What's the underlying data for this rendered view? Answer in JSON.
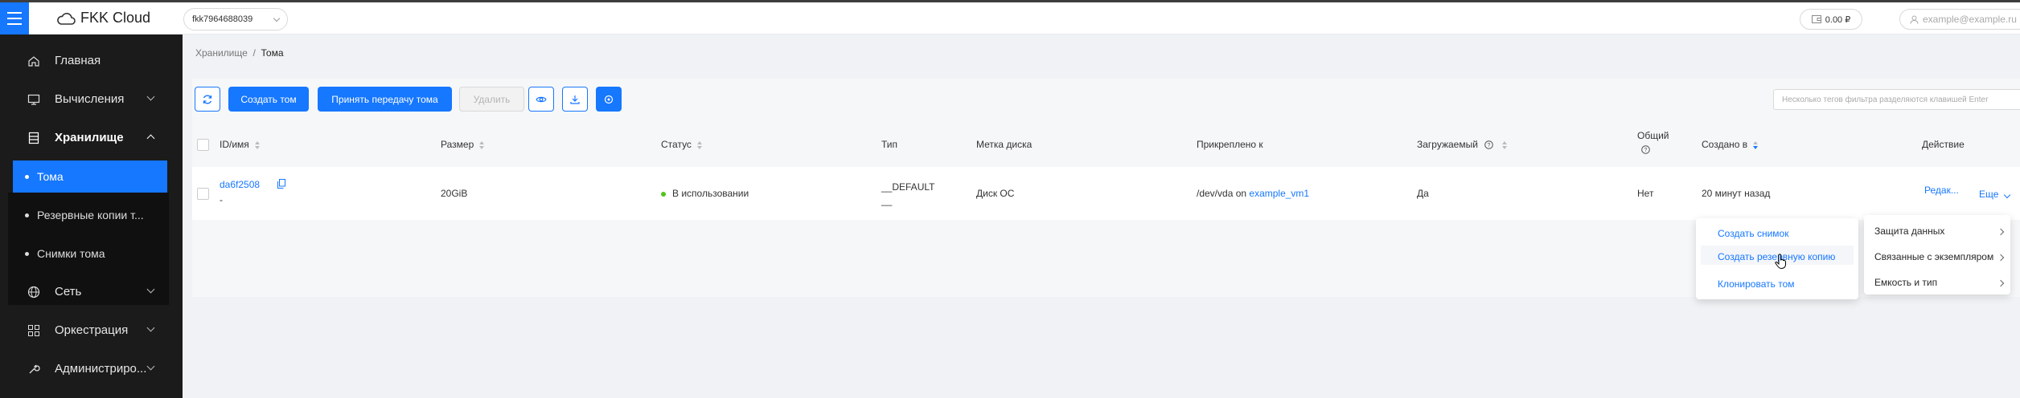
{
  "app": {
    "logo_text": "FKK Cloud",
    "project": "fkk7964688039",
    "balance": "0.00 ₽",
    "user": "example@example.ru"
  },
  "sidebar": {
    "items": [
      {
        "label": "Главная",
        "icon": "home-icon"
      },
      {
        "label": "Вычисления",
        "icon": "monitor-icon"
      },
      {
        "label": "Хранилище",
        "icon": "storage-icon"
      },
      {
        "label": "Сеть",
        "icon": "globe-icon"
      },
      {
        "label": "Оркестрация",
        "icon": "grid-icon"
      },
      {
        "label": "Администриро...",
        "icon": "wrench-icon"
      }
    ],
    "sub_items": [
      {
        "label": "Тома"
      },
      {
        "label": "Резервные копии т..."
      },
      {
        "label": "Снимки тома"
      }
    ]
  },
  "breadcrumb": {
    "parent": "Хранилище",
    "separator": "/",
    "current": "Тома"
  },
  "toolbar": {
    "create_label": "Создать том",
    "accept_label": "Принять передачу тома",
    "delete_label": "Удалить",
    "filter_placeholder": "Несколько тегов фильтра разделяются клавишей Enter"
  },
  "table": {
    "headers": {
      "id": "ID/имя",
      "size": "Размер",
      "status": "Статус",
      "type": "Тип",
      "label": "Метка диска",
      "attached": "Прикреплено к",
      "bootable": "Загружаемый",
      "shared": "Общий",
      "created": "Создано в",
      "action": "Действие"
    },
    "row": {
      "id": "da6f2508",
      "name": "-",
      "size": "20GiB",
      "status": "В использовании",
      "type_line1": "__DEFAULT",
      "type_line2": "__",
      "label": "Диск ОС",
      "attached_prefix": "/dev/vda on",
      "attached_link": "example_vm1",
      "bootable": "Да",
      "shared": "Нет",
      "created": "20 минут назад",
      "edit": "Редак...",
      "more": "Еще"
    }
  },
  "menu_left": {
    "items": [
      {
        "label": "Создать снимок"
      },
      {
        "label": "Создать резервную копию"
      },
      {
        "label": "Клонировать том"
      }
    ]
  },
  "menu_right": {
    "items": [
      {
        "label": "Защита данных"
      },
      {
        "label": "Связанные с экземпляром"
      },
      {
        "label": "Емкость и тип"
      }
    ]
  },
  "colors": {
    "accent": "#1677ff",
    "sidebar_bg": "#1b1b1b",
    "status_green": "#52c41a"
  }
}
